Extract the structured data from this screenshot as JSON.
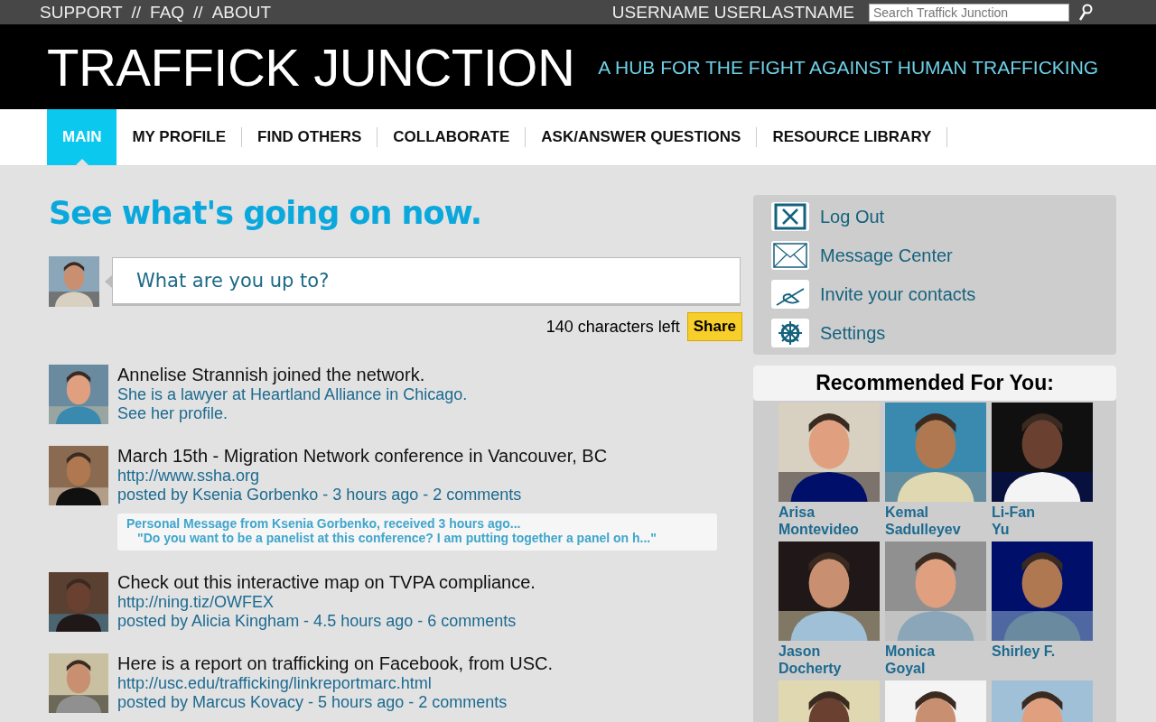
{
  "top_bar": {
    "links": [
      "SUPPORT",
      "FAQ",
      "ABOUT"
    ],
    "separator": "//",
    "username": "USERNAME USERLASTNAME",
    "search": {
      "placeholder": "Search Traffick Junction"
    }
  },
  "header": {
    "title": "TRAFFICK JUNCTION",
    "tagline": "A HUB FOR THE FIGHT AGAINST HUMAN TRAFFICKING"
  },
  "nav": [
    {
      "label": "MAIN",
      "selected": true
    },
    {
      "label": "MY PROFILE",
      "selected": false
    },
    {
      "label": "FIND OTHERS",
      "selected": false
    },
    {
      "label": "COLLABORATE",
      "selected": false
    },
    {
      "label": "ASK/ANSWER QUESTIONS",
      "selected": false
    },
    {
      "label": "RESOURCE LIBRARY",
      "selected": false
    }
  ],
  "feed_heading": "See what's going on now.",
  "status": {
    "placeholder": "What are you up to?",
    "counter": "140 characters left",
    "share": "Share"
  },
  "feed": [
    {
      "title": "Annelise Strannish joined the network.",
      "lines": [
        "She is a lawyer at Heartland Alliance in Chicago.",
        "See her profile."
      ]
    },
    {
      "title": "March 15th - Migration Network conference in Vancouver, BC",
      "lines": [
        "http://www.ssha.org",
        "posted by Ksenia Gorbenko - 3 hours ago  -  2 comments"
      ],
      "message": {
        "heading": "Personal Message from Ksenia Gorbenko, received 3 hours ago...",
        "quote": "\"Do you want to be a panelist at this conference? I am putting together a panel on h...\""
      }
    },
    {
      "title": "Check out this interactive map on TVPA compliance.",
      "lines": [
        "http://ning.tiz/OWFEX",
        "posted by Alicia Kingham - 4.5 hours ago - 6 comments"
      ]
    },
    {
      "title": "Here is a report on trafficking on Facebook, from USC.",
      "lines": [
        "http://usc.edu/trafficking/linkreportmarc.html",
        "posted by Marcus Kovacy - 5 hours ago - 2 comments"
      ]
    }
  ],
  "account_menu": [
    {
      "kind": "logout",
      "label": "Log Out"
    },
    {
      "kind": "message",
      "label": "Message Center"
    },
    {
      "kind": "invite",
      "label": "Invite your contacts"
    },
    {
      "kind": "settings",
      "label": "Settings"
    }
  ],
  "recommended": {
    "title": "Recommended For You:",
    "people": [
      {
        "kind": "person",
        "name_lines": [
          "Arisa",
          "Montevideo"
        ]
      },
      {
        "kind": "person",
        "name_lines": [
          "Kemal",
          "Sadulleyev"
        ]
      },
      {
        "kind": "person",
        "name_lines": [
          "Li-Fan",
          "Yu"
        ]
      },
      {
        "kind": "person",
        "name_lines": [
          "Jason",
          "Docherty"
        ]
      },
      {
        "kind": "person",
        "name_lines": [
          "Monica",
          "Goyal"
        ]
      },
      {
        "kind": "person",
        "name_lines": [
          "Shirley F."
        ]
      },
      {
        "kind": "cut"
      },
      {
        "kind": "cut"
      },
      {
        "kind": "cut"
      }
    ]
  }
}
